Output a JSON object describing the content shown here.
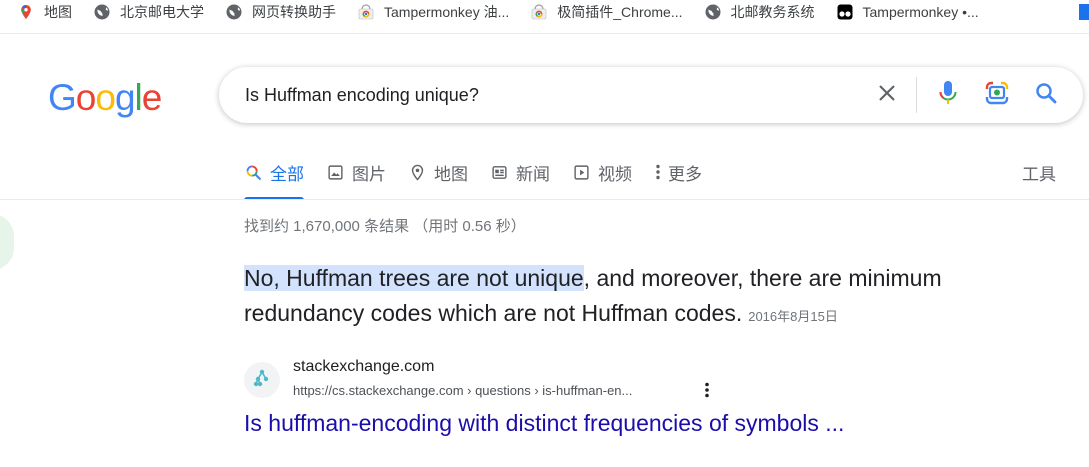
{
  "bookmarks": [
    {
      "label": "地图",
      "icon": "maps-pin-icon"
    },
    {
      "label": "北京邮电大学",
      "icon": "globe-icon"
    },
    {
      "label": "网页转换助手",
      "icon": "globe-icon"
    },
    {
      "label": "Tampermonkey 油...",
      "icon": "chrome-web-store-icon"
    },
    {
      "label": "极简插件_Chrome...",
      "icon": "chrome-web-store-icon"
    },
    {
      "label": "北邮教务系统",
      "icon": "globe-icon"
    },
    {
      "label": "Tampermonkey •...",
      "icon": "tampermonkey-icon"
    }
  ],
  "header": {
    "logo": "Google",
    "query": "Is Huffman encoding unique?"
  },
  "tabs": [
    {
      "label": "全部",
      "icon": "search-icon",
      "active": true
    },
    {
      "label": "图片",
      "icon": "image-icon",
      "active": false
    },
    {
      "label": "地图",
      "icon": "map-pin-icon",
      "active": false
    },
    {
      "label": "新闻",
      "icon": "news-icon",
      "active": false
    },
    {
      "label": "视频",
      "icon": "video-icon",
      "active": false
    },
    {
      "label": "更多",
      "icon": "more-vert-icon",
      "active": false
    }
  ],
  "tools_label": "工具",
  "stats": "找到约 1,670,000 条结果 （用时 0.56 秒）",
  "snippet": {
    "highlight": "No, Huffman trees are not unique",
    "rest": ", and moreover, there are minimum redundancy codes which are not Huffman codes.",
    "date": "2016年8月15日"
  },
  "result": {
    "site": "stackexchange.com",
    "url": "https://cs.stackexchange.com › questions › is-huffman-en...",
    "title": "Is huffman-encoding with distinct frequencies of symbols ..."
  },
  "colors": {
    "accent": "#1a73e8",
    "link": "#1a0dab",
    "highlight": "#d3e3fd"
  }
}
